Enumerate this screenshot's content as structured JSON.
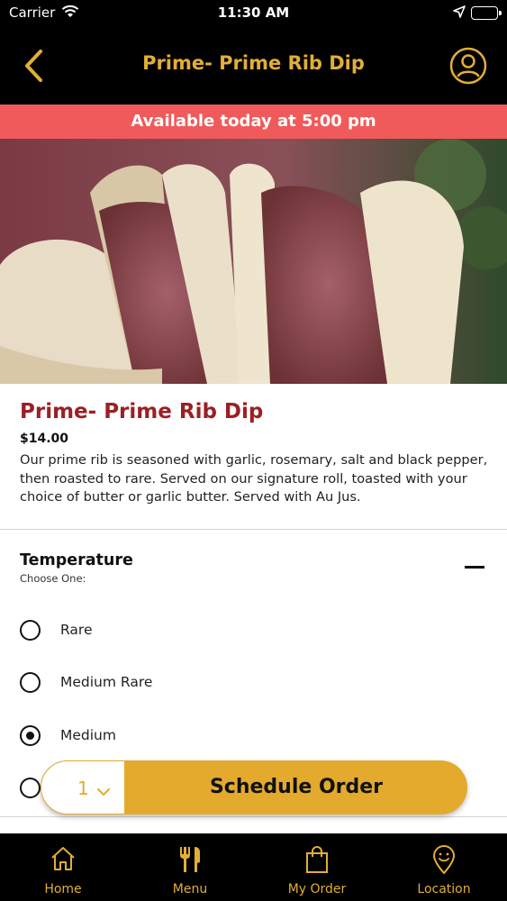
{
  "status_bar": {
    "carrier": "Carrier",
    "time": "11:30 AM"
  },
  "header": {
    "title": "Prime- Prime Rib Dip",
    "back_icon": "chevron-left-icon",
    "profile_icon": "user-circle-icon"
  },
  "banner": {
    "availability": "Available today at 5:00 pm"
  },
  "item": {
    "name": "Prime- Prime Rib Dip",
    "price": "$14.00",
    "description": "Our prime rib is seasoned with garlic, rosemary, salt and black pepper, then roasted to rare. Served on our signature roll, toasted with your choice of butter or garlic butter. Served with Au Jus."
  },
  "options": {
    "title": "Temperature",
    "subtitle": "Choose One:",
    "choices": [
      {
        "label": "Rare",
        "selected": false
      },
      {
        "label": "Medium Rare",
        "selected": false
      },
      {
        "label": "Medium",
        "selected": true
      },
      {
        "label": "",
        "selected": false
      }
    ]
  },
  "order_bar": {
    "quantity": "1",
    "schedule_label": "Schedule Order"
  },
  "tabs": [
    {
      "label": "Home",
      "icon": "home-icon"
    },
    {
      "label": "Menu",
      "icon": "fork-knife-icon"
    },
    {
      "label": "My Order",
      "icon": "shopping-bag-icon"
    },
    {
      "label": "Location",
      "icon": "location-smiley-icon"
    }
  ],
  "colors": {
    "accent": "#e2ae38",
    "banner": "#f15a5a",
    "item_name": "#9c1f25",
    "bar_background": "#000000"
  }
}
